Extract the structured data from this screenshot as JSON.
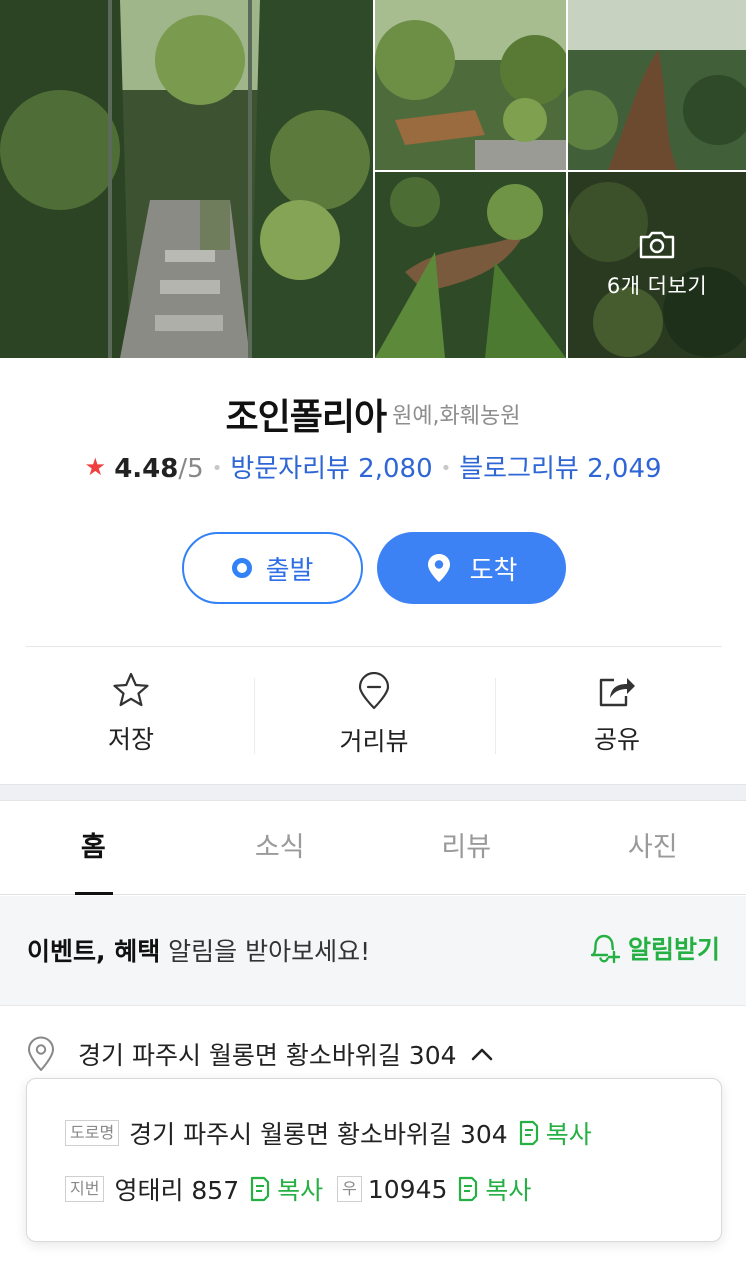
{
  "gallery": {
    "more_label": "6개 더보기"
  },
  "place": {
    "name": "조인폴리아",
    "category": "원예,화훼농원",
    "rating": "4.48",
    "rating_max": "/5",
    "visitor_reviews": "방문자리뷰 2,080",
    "blog_reviews": "블로그리뷰 2,049"
  },
  "route": {
    "depart_label": "출발",
    "arrive_label": "도착"
  },
  "actions": {
    "save_label": "저장",
    "street_view_label": "거리뷰",
    "share_label": "공유"
  },
  "tabs": [
    "홈",
    "소식",
    "리뷰",
    "사진"
  ],
  "banner": {
    "bold_text": "이벤트, 혜택",
    "rest_text": " 알림을 받아보세요!",
    "button_label": "알림받기"
  },
  "address": {
    "main": "경기 파주시 월롱면 황소바위길 304",
    "road_tag": "도로명",
    "road_value": "경기 파주시 월롱면 황소바위길 304",
    "lot_tag": "지번",
    "lot_value": "영태리 857",
    "zip_tag": "우",
    "zip_value": "10945",
    "copy_label": "복사"
  },
  "colors": {
    "accent_blue": "#3182f6",
    "link_blue": "#2f66d6",
    "green": "#25b043",
    "star_red": "#f03f3f"
  }
}
